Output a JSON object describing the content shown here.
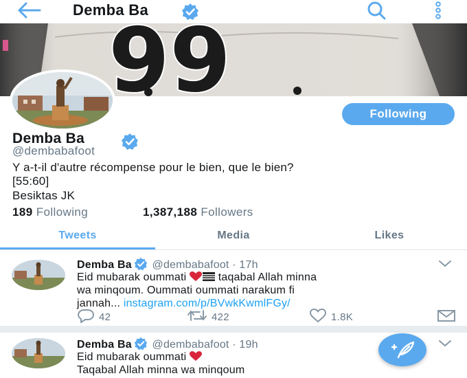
{
  "header": {
    "title": "Demba Ba",
    "back_icon": "back-arrow-icon",
    "search_icon": "search-icon",
    "more_icon": "more-vertical-icon"
  },
  "colors": {
    "accent": "#5aa9ee",
    "link": "#1da1f2",
    "text_secondary": "#657786",
    "divider": "#e6ecf0"
  },
  "banner": {
    "jersey_number": "99"
  },
  "profile": {
    "name": "Demba Ba",
    "handle": "@dembabafoot",
    "follow_button": "Following",
    "bio_line1": "Y a-t-il d'autre récompense pour le bien, que le bien?",
    "bio_line2": "[55:60]",
    "location": "Besiktas JK",
    "following_count": "189",
    "following_label": "Following",
    "followers_count": "1,387,188",
    "followers_label": "Followers"
  },
  "tabs": [
    {
      "label": "Tweets",
      "active": true
    },
    {
      "label": "Media",
      "active": false
    },
    {
      "label": "Likes",
      "active": false
    }
  ],
  "tweets": [
    {
      "name": "Demba Ba",
      "handle": "@dembabafoot",
      "time": "· 17h",
      "text_line1_a": "Eid mubarak oummati ",
      "text_line1_b": " taqabal Allah minna",
      "text_line2": "wa minqoum. Oummati oummati narakum fi",
      "text_line3": "jannah... ",
      "link": "instagram.com/p/BVwkKwmlFGy/",
      "replies": "42",
      "retweets": "422",
      "likes": "1.8K"
    },
    {
      "name": "Demba Ba",
      "handle": "@dembabafoot",
      "time": "· 19h",
      "text_line1": "Eid mubarak oummati ",
      "text_line2": "Taqabal Allah minna wa minqoum"
    }
  ],
  "fab": {
    "icon": "compose-tweet-icon"
  }
}
